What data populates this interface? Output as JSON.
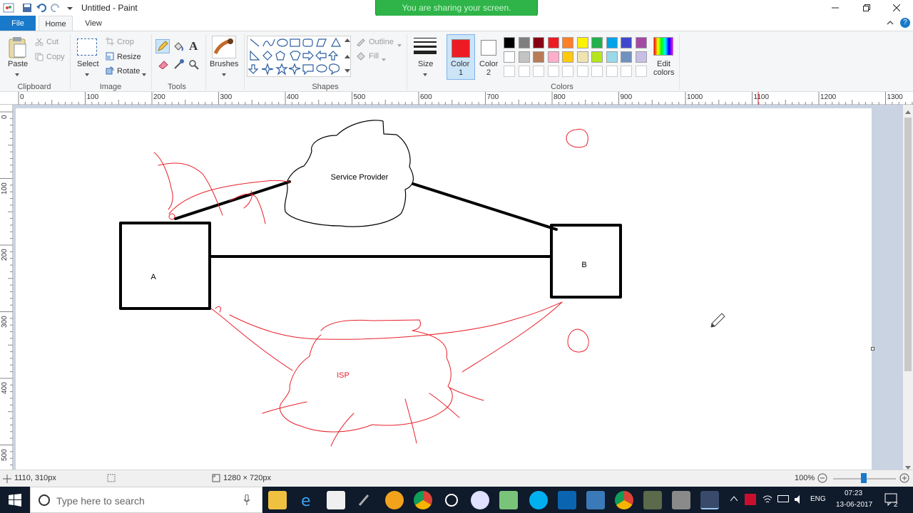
{
  "window": {
    "title": "Untitled - Paint",
    "share_banner": "You are sharing your screen."
  },
  "menu": {
    "file": "File",
    "home": "Home",
    "view": "View"
  },
  "ribbon": {
    "clipboard": {
      "paste": "Paste",
      "cut": "Cut",
      "copy": "Copy",
      "label": "Clipboard"
    },
    "image": {
      "select": "Select",
      "crop": "Crop",
      "resize": "Resize",
      "rotate": "Rotate",
      "label": "Image"
    },
    "tools": {
      "label": "Tools",
      "text_glyph": "A"
    },
    "brushes": {
      "label": "Brushes"
    },
    "shapes": {
      "outline": "Outline",
      "fill": "Fill",
      "label": "Shapes"
    },
    "size": {
      "label": "Size"
    },
    "colors": {
      "color1": "Color",
      "color1_num": "1",
      "color2": "Color",
      "color2_num": "2",
      "edit_colors_1": "Edit",
      "edit_colors_2": "colors",
      "label": "Colors",
      "active_color1": "#ed1c24",
      "active_color2": "#ffffff",
      "palette_row1": [
        "#000000",
        "#7f7f7f",
        "#880015",
        "#ed1c24",
        "#ff7f27",
        "#fff200",
        "#22b14c",
        "#00a2e8",
        "#3f48cc",
        "#a349a4"
      ],
      "palette_row2": [
        "#ffffff",
        "#c3c3c3",
        "#b97a57",
        "#ffaec9",
        "#ffc90e",
        "#efe4b0",
        "#b5e61d",
        "#99d9ea",
        "#7092be",
        "#c8bfe7"
      ]
    }
  },
  "ruler": {
    "h_labels": [
      "0",
      "100",
      "200",
      "300",
      "400",
      "500",
      "600",
      "700",
      "800",
      "900",
      "1000",
      "1100",
      "1200",
      "1300"
    ],
    "v_labels": [
      "0",
      "100",
      "200",
      "300",
      "400",
      "500"
    ]
  },
  "drawing": {
    "service_provider": "Service Provider",
    "box_a": "A",
    "box_b": "B",
    "isp": "ISP",
    "ink_black": "#000000",
    "ink_red": "#e8202a"
  },
  "status": {
    "cursor_pos": "1110, 310px",
    "image_size": "1280 × 720px",
    "zoom": "100%"
  },
  "taskbar": {
    "search_placeholder": "Type here to search",
    "language": "ENG",
    "time": "07:23",
    "date": "13-06-2017",
    "notifications": "2"
  }
}
